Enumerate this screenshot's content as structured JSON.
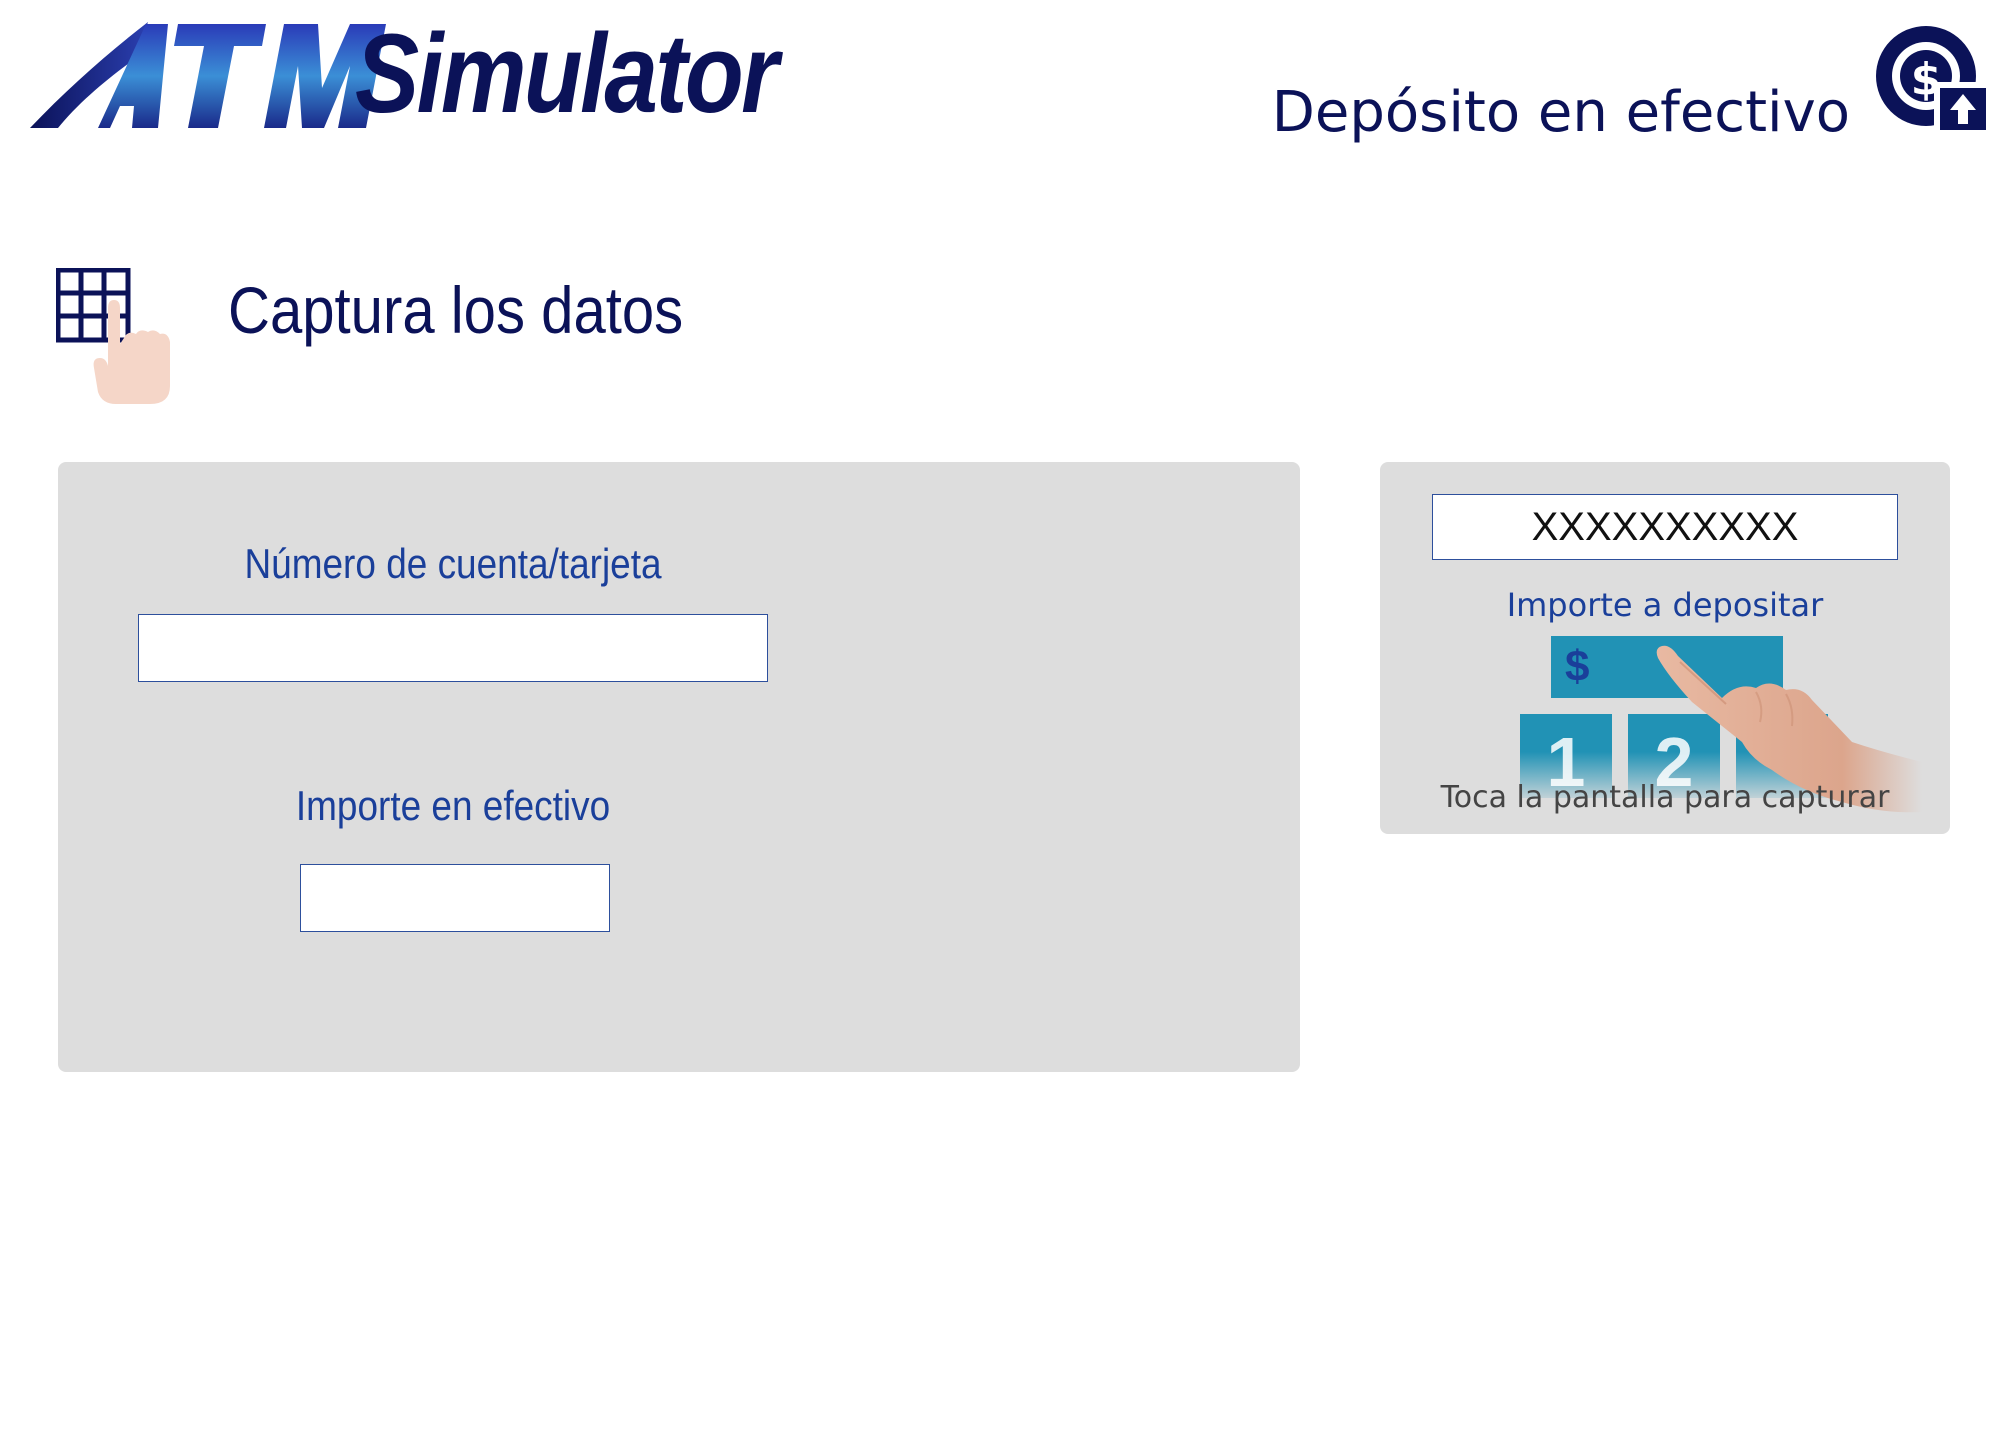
{
  "header": {
    "logo_text": "Simulator",
    "logo_mark": "ATM",
    "title": "Depósito en efectivo",
    "icon": "cash-deposit-icon"
  },
  "section": {
    "title": "Captura los datos",
    "icon": "keypad-touch-icon"
  },
  "form": {
    "account_label": "Número de cuenta/tarjeta",
    "account_value": "",
    "cash_label": "Importe en efectivo",
    "cash_value": ""
  },
  "hint": {
    "box_text": "XXXXXXXXXX",
    "amount_label": "Importe a depositar",
    "currency_symbol": "$",
    "keys": [
      "1",
      "2",
      ""
    ],
    "caption": "Toca la pantalla para capturar"
  },
  "colors": {
    "brand_navy": "#0b1258",
    "label_blue": "#1a3f9a",
    "panel_gray": "#dddddd",
    "key_teal": "#2192b5"
  }
}
